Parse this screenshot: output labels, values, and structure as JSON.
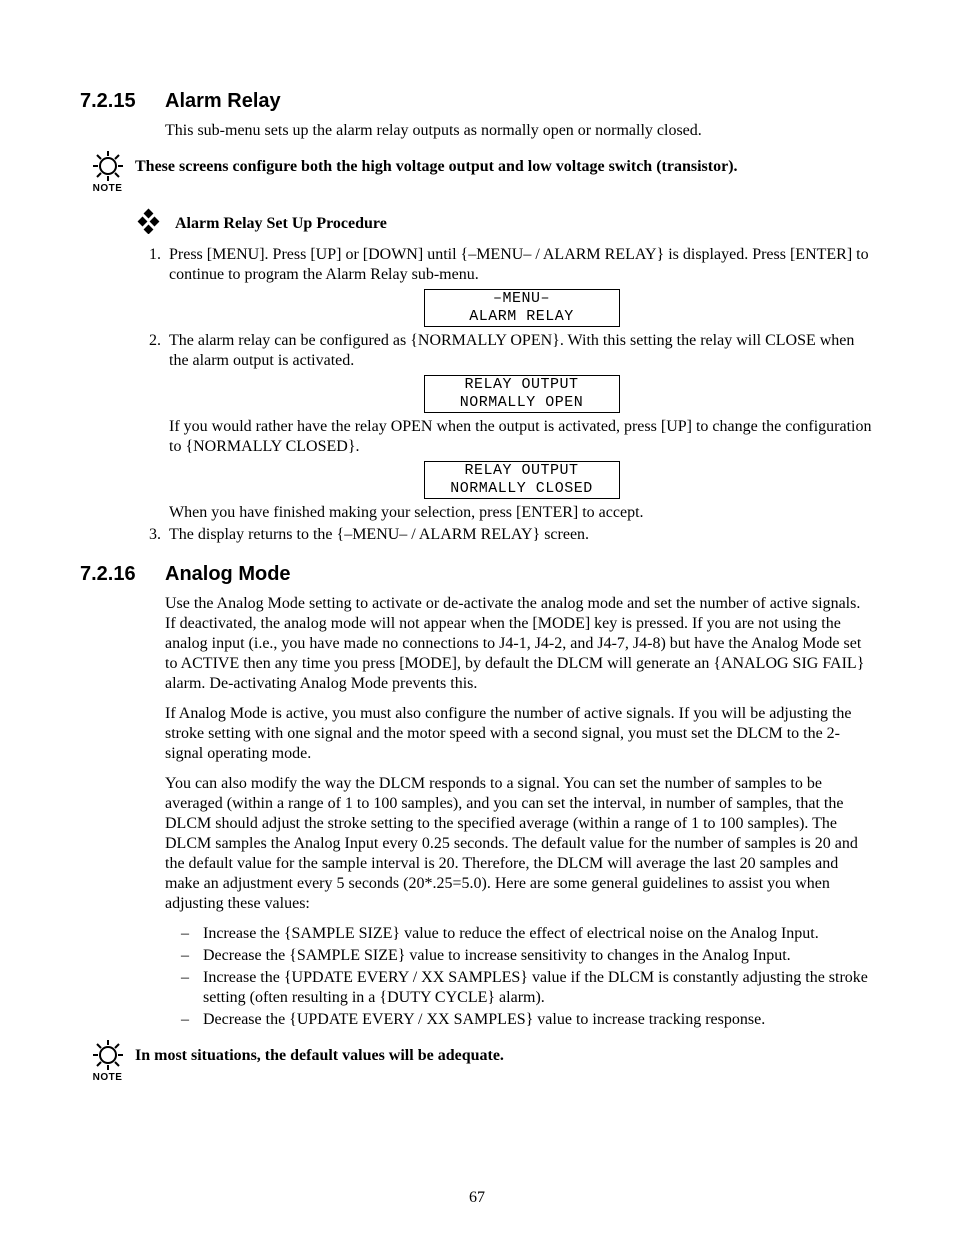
{
  "pageNumber": "67",
  "noteLabel": "NOTE",
  "sec1": {
    "num": "7.2.15",
    "title": "Alarm Relay",
    "intro": "This sub-menu sets up the alarm relay outputs as normally open or normally closed.",
    "noteText": "These screens configure both the high voltage output and low voltage switch (transistor).",
    "procTitle": "Alarm Relay Set Up Procedure",
    "step1": "Press [MENU].  Press [UP] or [DOWN] until {–MENU– / ALARM RELAY} is displayed.  Press [ENTER] to continue to program the Alarm Relay sub-menu.",
    "screen1a": "–MENU–",
    "screen1b": "ALARM RELAY",
    "step2a": "The alarm relay can be configured as {NORMALLY OPEN}.  With this setting the relay will CLOSE when the alarm output is activated.",
    "screen2a": "RELAY OUTPUT",
    "screen2b": "NORMALLY OPEN",
    "step2b": "If you would rather have the relay OPEN when the output is activated, press [UP] to change the configuration to {NORMALLY CLOSED}.",
    "screen3a": "RELAY OUTPUT",
    "screen3b": "NORMALLY CLOSED",
    "step2c": "When you have finished making your selection, press [ENTER] to accept.",
    "step3": "The display returns to the {–MENU– / ALARM RELAY} screen."
  },
  "sec2": {
    "num": "7.2.16",
    "title": "Analog Mode",
    "p1": "Use the Analog Mode setting to activate or de-activate the analog mode and set the number of active signals.  If deactivated, the analog mode will not appear when the [MODE] key is pressed.  If you are not using the analog input (i.e., you have made no connections to J4-1, J4-2, and J4-7, J4-8) but have the Analog Mode set to ACTIVE then any time you press [MODE], by default the DLCM will generate an {ANALOG SIG FAIL} alarm.  De-activating Analog Mode prevents this.",
    "p2": "If Analog Mode is active, you must also configure the number of active signals.  If you will be adjusting the stroke setting with one signal and the motor speed with a second signal, you must set the DLCM to the 2-signal operating mode.",
    "p3": "You can also modify the way the DLCM responds to a signal.  You can set the number of samples to be averaged (within a range of 1 to 100 samples), and you can set the interval, in number of samples, that the DLCM should adjust the stroke setting to the specified average (within a range of 1 to 100 samples).  The DLCM samples the Analog Input every 0.25 seconds.  The default value for the number of samples is 20 and the default value for the sample interval is 20.  Therefore, the DLCM will average the last 20 samples and make an adjustment every 5 seconds (20*.25=5.0).  Here are some general guidelines to assist you when adjusting these values:",
    "b1": "Increase the {SAMPLE SIZE} value to reduce the effect of electrical noise on the Analog Input.",
    "b2": "Decrease the {SAMPLE SIZE} value to increase sensitivity to changes in the Analog Input.",
    "b3": "Increase the {UPDATE EVERY / XX SAMPLES} value if the DLCM is constantly adjusting the stroke setting (often resulting in a {DUTY CYCLE} alarm).",
    "b4": "Decrease the {UPDATE EVERY / XX SAMPLES} value to increase tracking response.",
    "noteText": "In most situations, the default values will be adequate."
  }
}
